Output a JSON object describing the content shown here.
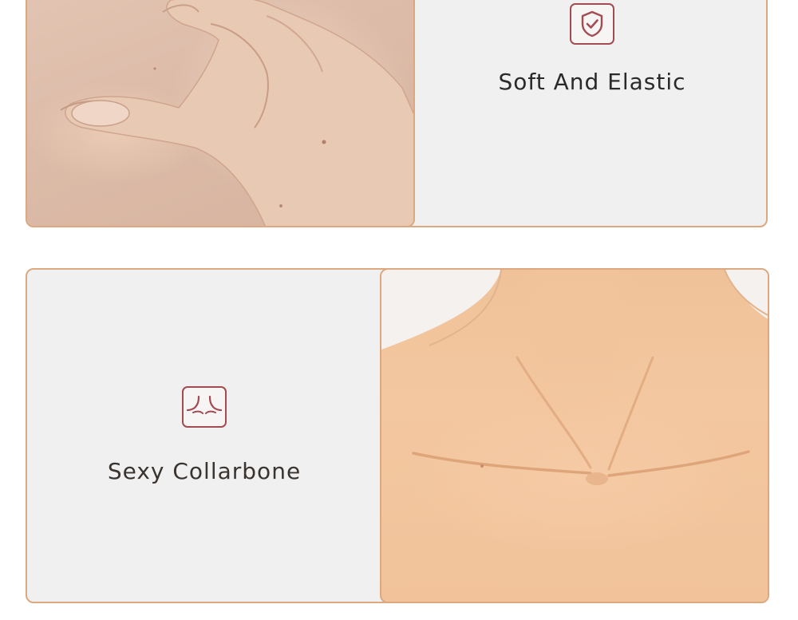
{
  "features": [
    {
      "title": "Soft And Elastic",
      "icon": "shield-check-icon",
      "photo": "hand-pinching-skin-photo"
    },
    {
      "title": "Sexy Collarbone",
      "icon": "collarbone-icon",
      "photo": "neck-collarbone-photo"
    }
  ],
  "colors": {
    "card_border": "#dca87f",
    "card_background": "#f1f0f0",
    "icon_accent": "#a24b52",
    "text": "#2a2a2a"
  }
}
